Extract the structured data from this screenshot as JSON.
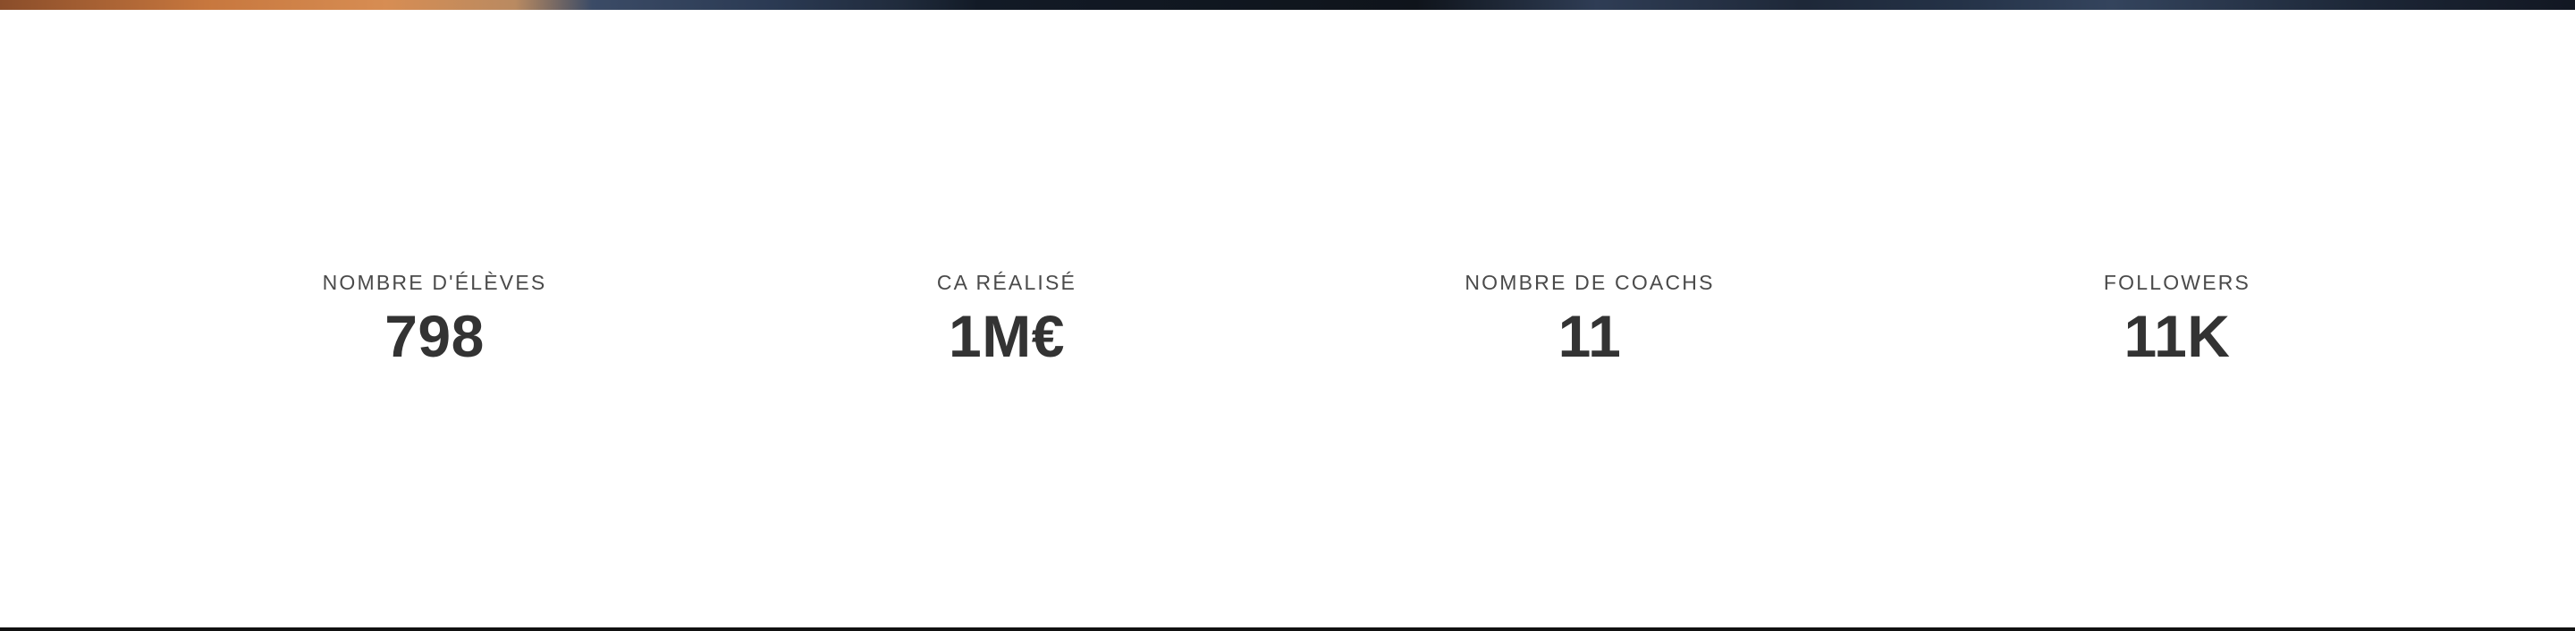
{
  "colors": {
    "text": "#333333",
    "label": "#4a4a4a",
    "background": "#ffffff",
    "bottom_rule": "#111111"
  },
  "stats": [
    {
      "label": "NOMBRE D'ÉLÈVES",
      "value": "798"
    },
    {
      "label": "CA RÉALISÉ",
      "value": "1M€"
    },
    {
      "label": "NOMBRE DE COACHS",
      "value": "11"
    },
    {
      "label": "FOLLOWERS",
      "value": "11K"
    }
  ]
}
